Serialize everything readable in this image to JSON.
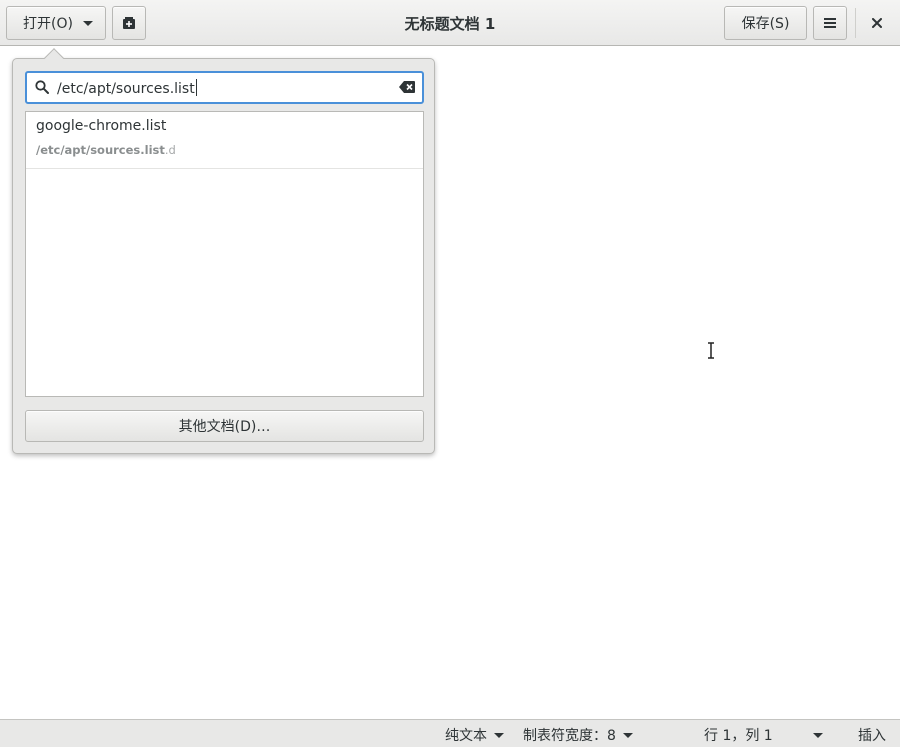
{
  "header": {
    "open_label": "打开(O)",
    "title": "无标题文档 1",
    "save_label": "保存(S)"
  },
  "popover": {
    "search": {
      "value": "/etc/apt/sources.list",
      "placeholder": ""
    },
    "results": [
      {
        "name": "google-chrome.list",
        "path_match": "/etc/apt/sources.list",
        "path_rest": ".d"
      }
    ],
    "other_documents_label": "其他文档(D)…"
  },
  "statusbar": {
    "language": "纯文本",
    "tab_width": "制表符宽度：8",
    "position": "行 1，列 1",
    "mode": "插入"
  },
  "icons": {
    "open_dropdown": "chevron-down-icon",
    "new_tab": "new-document-icon",
    "menu": "hamburger-menu-icon",
    "close": "close-icon",
    "search": "search-icon",
    "clear": "clear-text-icon"
  },
  "colors": {
    "focus_border": "#4a90d9",
    "header_bg": "#e8e8e7",
    "text": "#2e3436"
  }
}
